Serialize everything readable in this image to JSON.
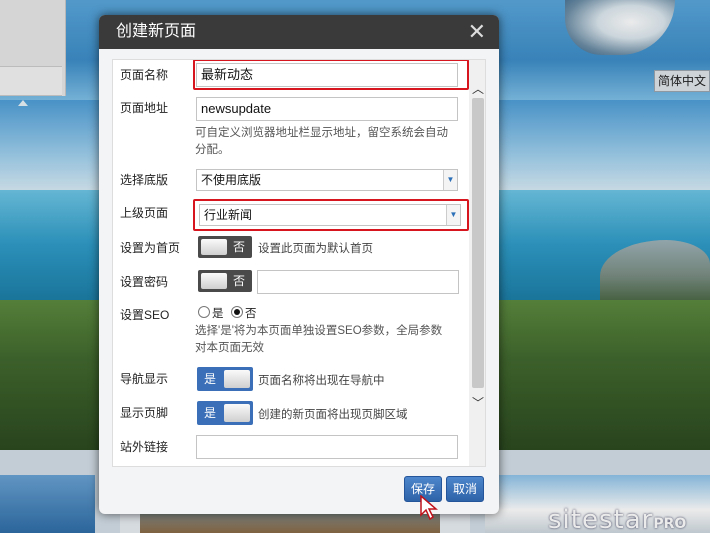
{
  "background": {
    "language_button": "简体中文",
    "logo": "sitestar",
    "logo_suffix": "PRO"
  },
  "dialog": {
    "title": "创建新页面",
    "close_icon": "close-icon",
    "fields": {
      "page_name": {
        "label": "页面名称",
        "value": "最新动态"
      },
      "page_url": {
        "label": "页面地址",
        "value": "newsupdate",
        "hint_line1": "可自定义浏览器地址栏显示地址，留空系统会自动",
        "hint_line2": "分配。"
      },
      "template": {
        "label": "选择底版",
        "value": "不使用底版"
      },
      "parent_page": {
        "label": "上级页面",
        "value": "行业新闻"
      },
      "set_home": {
        "label": "设置为首页",
        "toggle": "否",
        "hint": "设置此页面为默认首页"
      },
      "password": {
        "label": "设置密码",
        "toggle": "否",
        "value": ""
      },
      "seo": {
        "label": "设置SEO",
        "option_yes": "是",
        "option_no": "否",
        "selected": "否",
        "hint_line1": "选择'是'将为本页面单独设置SEO参数，全局参数",
        "hint_line2": "对本页面无效"
      },
      "nav_display": {
        "label": "导航显示",
        "toggle": "是",
        "hint": "页面名称将出现在导航中"
      },
      "footer_display": {
        "label": "显示页脚",
        "toggle": "是",
        "hint": "创建的新页面将出现页脚区域"
      },
      "external_link": {
        "label": "站外链接",
        "value": ""
      }
    },
    "buttons": {
      "save": "保存",
      "cancel": "取消"
    }
  },
  "colors": {
    "title_bar": "#3a3a3a",
    "highlight": "#d6151f",
    "primary_button": "#3b6fb8"
  }
}
